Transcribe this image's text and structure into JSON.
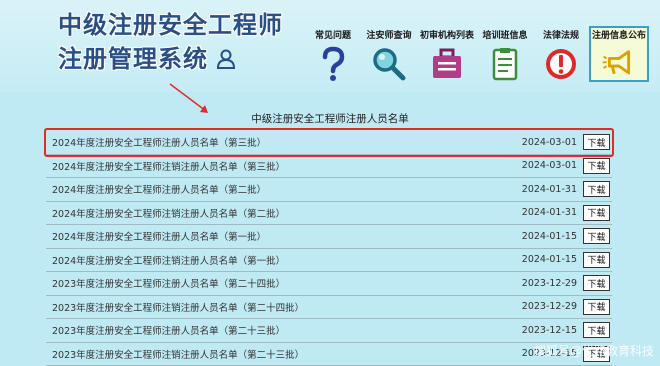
{
  "header": {
    "title_line1": "中级注册安全工程师",
    "title_line2": "注册管理系统"
  },
  "nav": {
    "items": [
      {
        "label": "常见问题",
        "icon": "question-mark-icon"
      },
      {
        "label": "注安师查询",
        "icon": "magnifier-icon"
      },
      {
        "label": "初审机构列表",
        "icon": "briefcase-icon"
      },
      {
        "label": "培训班信息",
        "icon": "clipboard-icon"
      },
      {
        "label": "法律法规",
        "icon": "exclamation-icon"
      },
      {
        "label": "注册信息公布",
        "icon": "megaphone-icon"
      }
    ]
  },
  "list": {
    "title": "中级注册安全工程师注册人员名单",
    "button_label": "下载",
    "rows": [
      {
        "title": "2024年度注册安全工程师注册人员名单（第三批）",
        "date": "2024-03-01"
      },
      {
        "title": "2024年度注册安全工程师注销注册人员名单（第三批）",
        "date": "2024-03-01"
      },
      {
        "title": "2024年度注册安全工程师注册人员名单（第二批）",
        "date": "2024-01-31"
      },
      {
        "title": "2024年度注册安全工程师注销注册人员名单（第二批）",
        "date": "2024-01-31"
      },
      {
        "title": "2024年度注册安全工程师注册人员名单（第一批）",
        "date": "2024-01-15"
      },
      {
        "title": "2024年度注册安全工程师注销注册人员名单（第一批）",
        "date": "2024-01-15"
      },
      {
        "title": "2023年度注册安全工程师注册人员名单（第二十四批）",
        "date": "2023-12-29"
      },
      {
        "title": "2023年度注册安全工程师注销注册人员名单（第二十四批）",
        "date": "2023-12-29"
      },
      {
        "title": "2023年度注册安全工程师注册人员名单（第二十三批）",
        "date": "2023-12-15"
      },
      {
        "title": "2023年度注册安全工程师注销注册人员名单（第二十三批）",
        "date": "2023-12-15"
      }
    ]
  },
  "watermark": "搜狐号@优路教育科技",
  "colors": {
    "title": "#2a4f86",
    "highlight": "#e12b2b",
    "background": "#bfe9f3"
  }
}
